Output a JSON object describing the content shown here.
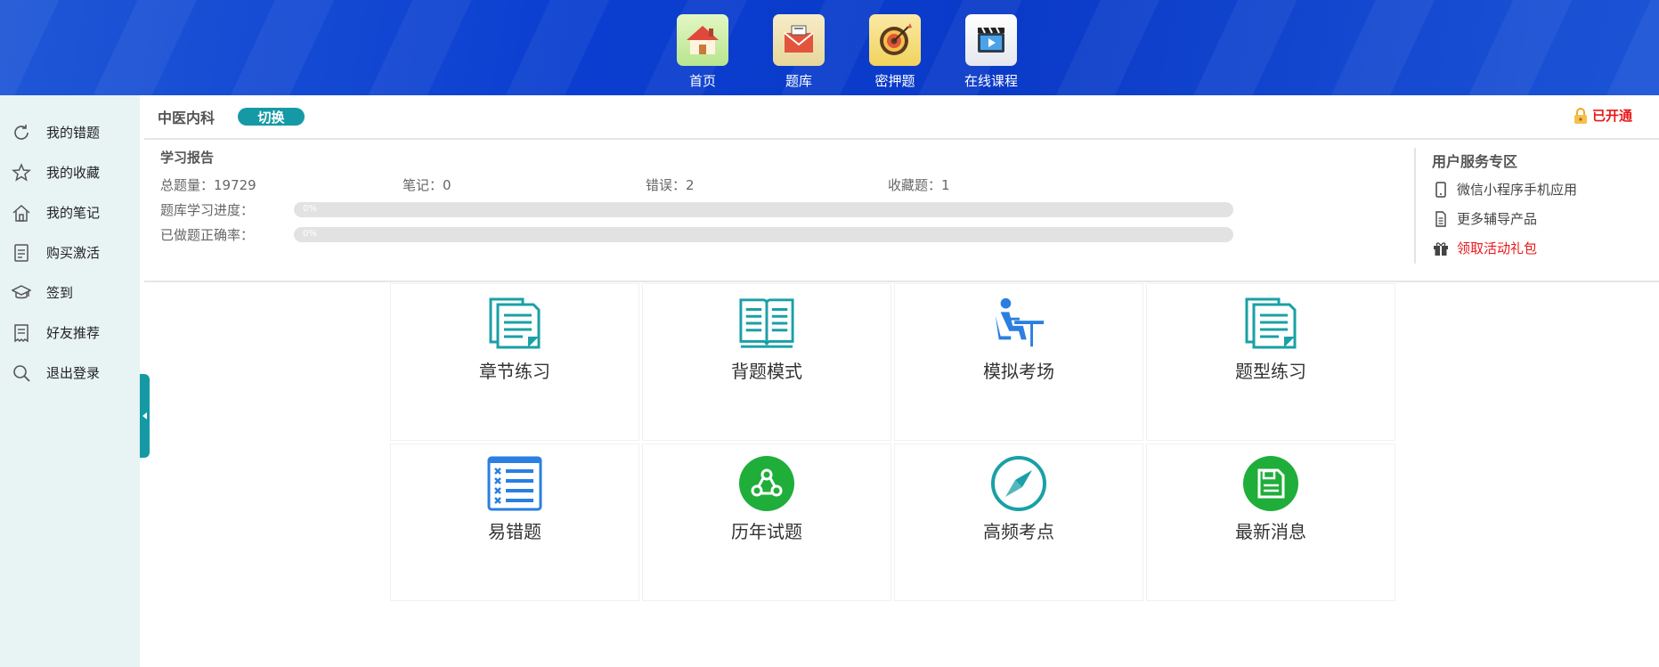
{
  "top_nav": [
    {
      "label": "首页",
      "icon": "home-icon"
    },
    {
      "label": "题库",
      "icon": "envelope-icon"
    },
    {
      "label": "密押题",
      "icon": "target-icon"
    },
    {
      "label": "在线课程",
      "icon": "video-clapper-icon"
    }
  ],
  "sidebar": {
    "items": [
      {
        "label": "我的错题",
        "icon": "refresh-icon"
      },
      {
        "label": "我的收藏",
        "icon": "star-icon"
      },
      {
        "label": "我的笔记",
        "icon": "house-outline-icon"
      },
      {
        "label": "购买激活",
        "icon": "document-icon"
      },
      {
        "label": "签到",
        "icon": "graduation-cap-icon"
      },
      {
        "label": "好友推荐",
        "icon": "receipt-icon"
      },
      {
        "label": "退出登录",
        "icon": "search-icon"
      }
    ]
  },
  "subject": {
    "name": "中医内科",
    "switch_label": "切换",
    "status": "已开通"
  },
  "report": {
    "title": "学习报告",
    "total": "总题量：19729",
    "notes": "笔记：0",
    "errors": "错误：2",
    "favorites": "收藏题：1",
    "progress_label": "题库学习进度：",
    "progress_text": "0%",
    "progress_value": 0,
    "accuracy_label": "已做题正确率：",
    "accuracy_text": "0%",
    "accuracy_value": 0
  },
  "service": {
    "title": "用户服务专区",
    "items": [
      {
        "label": "微信小程序手机应用",
        "icon": "mobile-phone-icon"
      },
      {
        "label": "更多辅导产品",
        "icon": "document-icon"
      },
      {
        "label": "领取活动礼包",
        "icon": "gift-icon"
      }
    ]
  },
  "functions": [
    {
      "label": "章节练习",
      "icon": "chapter-document-icon"
    },
    {
      "label": "背题模式",
      "icon": "open-book-icon"
    },
    {
      "label": "模拟考场",
      "icon": "exam-desk-icon"
    },
    {
      "label": "题型练习",
      "icon": "question-type-document-icon"
    },
    {
      "label": "易错题",
      "icon": "error-list-icon"
    },
    {
      "label": "历年试题",
      "icon": "past-papers-icon"
    },
    {
      "label": "高频考点",
      "icon": "compass-icon"
    },
    {
      "label": "最新消息",
      "icon": "floppy-save-icon"
    }
  ],
  "colors": {
    "banner": "#0b3ed0",
    "accent": "#159aa5",
    "alert_red": "#e8171a",
    "sidebar_bg": "#e8f3f4",
    "green_icon": "#1fae3a",
    "blue_icon": "#2a7fe0"
  }
}
